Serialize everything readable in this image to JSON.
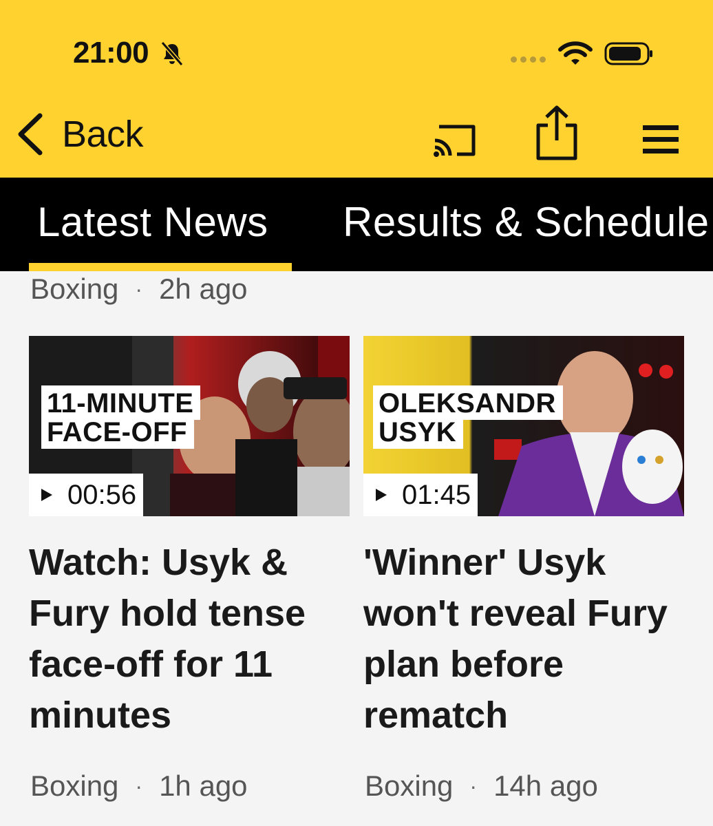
{
  "theme": {
    "accent": "#ffd230"
  },
  "status_bar": {
    "time": "21:00",
    "icons": [
      "bell-muted-icon",
      "signal-icon",
      "wifi-icon",
      "battery-icon"
    ]
  },
  "toolbar": {
    "back_label": "Back",
    "icons": [
      "chevron-left-icon",
      "cast-icon",
      "share-icon",
      "menu-icon"
    ]
  },
  "tabs": [
    {
      "label": "Latest News",
      "selected": true
    },
    {
      "label": "Results & Schedule",
      "selected": false
    }
  ],
  "previous_item_meta": {
    "category": "Boxing",
    "time": "2h ago"
  },
  "articles": [
    {
      "thumbnail_caption_lines": [
        "11-MINUTE",
        "FACE-OFF"
      ],
      "duration": "00:56",
      "headline": "Watch: Usyk & Fury hold tense face-off for 11 minutes",
      "category": "Boxing",
      "time": "1h ago"
    },
    {
      "thumbnail_caption_lines": [
        "OLEKSANDR",
        "USYK"
      ],
      "duration": "01:45",
      "headline": "'Winner' Usyk won't reveal Fury plan before rematch",
      "category": "Boxing",
      "time": "14h ago"
    }
  ]
}
